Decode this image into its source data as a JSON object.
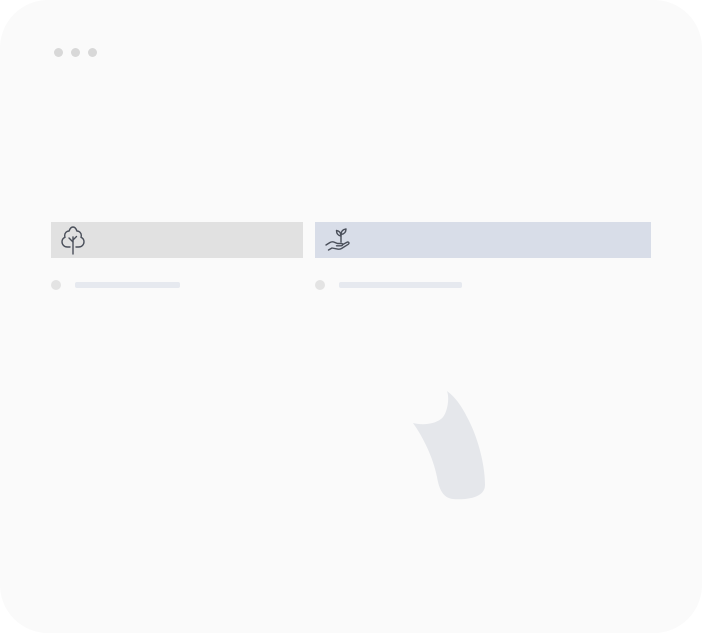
{
  "window": {
    "controls": [
      "dot-1",
      "dot-2",
      "dot-3"
    ]
  },
  "cards": [
    {
      "id": "tree-card",
      "icon": "tree-icon",
      "header_color": "#e1e1e1"
    },
    {
      "id": "plant-card",
      "icon": "hand-sprout-icon",
      "header_color": "#d8dde8"
    }
  ],
  "colors": {
    "window_background": "#fafafa",
    "placeholder_bar": "#e6e9ef",
    "icon_stroke": "#4a4f5a"
  }
}
